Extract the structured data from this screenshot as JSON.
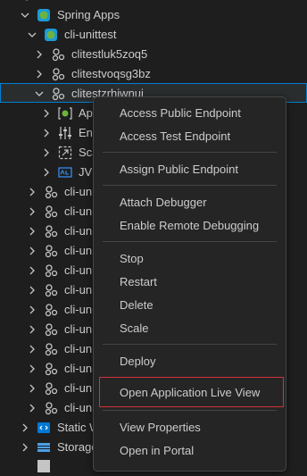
{
  "tree": {
    "root": {
      "label": "Spring Apps"
    },
    "service": {
      "label": "cli-unittest"
    },
    "apps": [
      {
        "label": "clitestluk5zoq5"
      },
      {
        "label": "clitestvoqsg3bz"
      },
      {
        "label": "clitestzrhjwnuj"
      }
    ],
    "app_children": [
      {
        "label": "Ap",
        "icon": "app-settings-icon"
      },
      {
        "label": "Env",
        "icon": "sliders-icon"
      },
      {
        "label": "Sca",
        "icon": "scale-icon"
      },
      {
        "label": "JVM",
        "icon": "jvm-icon"
      }
    ],
    "truncated_items": [
      "cli-un",
      "cli-un",
      "cli-un",
      "cli-un",
      "cli-un",
      "cli-un",
      "cli-un",
      "cli-un",
      "cli-un",
      "cli-un",
      "cli-un",
      "cli-un"
    ],
    "bottom": [
      {
        "label": "Static W"
      },
      {
        "label": "Storage"
      }
    ]
  },
  "context_menu": {
    "items": [
      "Access Public Endpoint",
      "Access Test Endpoint",
      "Assign Public Endpoint",
      "Attach Debugger",
      "Enable Remote Debugging",
      "Stop",
      "Restart",
      "Delete",
      "Scale",
      "Deploy",
      "Open Application Live View",
      "View Properties",
      "Open in Portal"
    ]
  },
  "colors": {
    "background": "#1e1e1e",
    "menu_background": "#252526",
    "selection_border": "#007fd4",
    "highlight_box": "#d13438",
    "spring_green": "#6db33f"
  }
}
